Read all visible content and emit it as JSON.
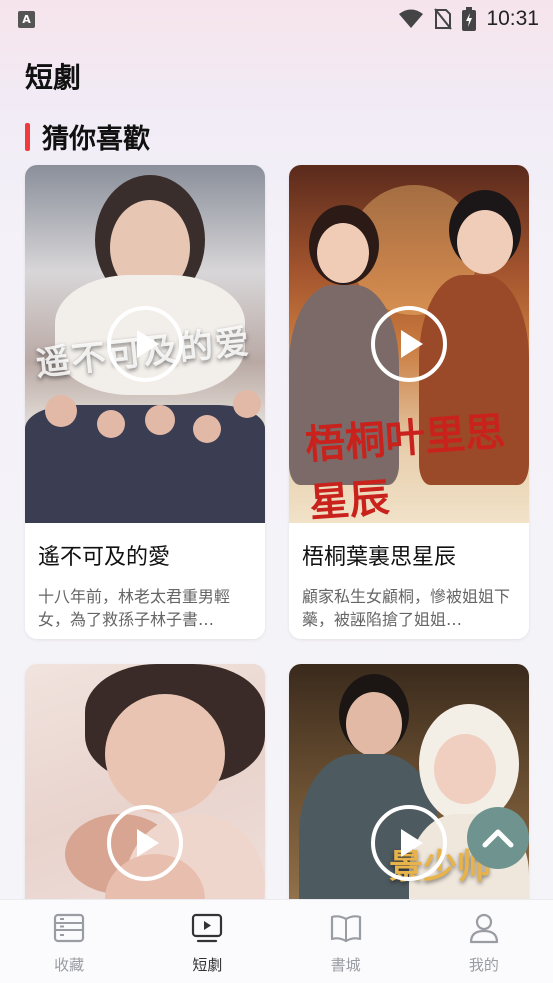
{
  "status_bar": {
    "app_icon_letter": "A",
    "time": "10:31",
    "icons": [
      "wifi-icon",
      "no-sim-icon",
      "battery-charging-icon"
    ]
  },
  "page": {
    "title": "短劇"
  },
  "section": {
    "title": "猜你喜歡",
    "accent_color": "#f23a3a"
  },
  "cards": [
    {
      "title": "遙不可及的愛",
      "description": "十八年前，林老太君重男輕女，為了救孫子林子書…",
      "poster_text": "遥不可及的爱"
    },
    {
      "title": "梧桐葉裏思星辰",
      "description": "顧家私生女顧桐，慘被姐姐下藥，被誣陷搶了姐姐…",
      "poster_text": "梧桐叶里思星辰"
    },
    {
      "title": "",
      "description": "",
      "poster_text": ""
    },
    {
      "title": "",
      "description": "",
      "poster_text": "景少帅"
    }
  ],
  "scroll_top_button": {
    "icon": "chevron-up-icon",
    "color": "#6f9490"
  },
  "bottom_nav": [
    {
      "label": "收藏",
      "icon": "collection-icon",
      "active": false
    },
    {
      "label": "短劇",
      "icon": "video-icon",
      "active": true
    },
    {
      "label": "書城",
      "icon": "book-icon",
      "active": false
    },
    {
      "label": "我的",
      "icon": "user-icon",
      "active": false
    }
  ]
}
